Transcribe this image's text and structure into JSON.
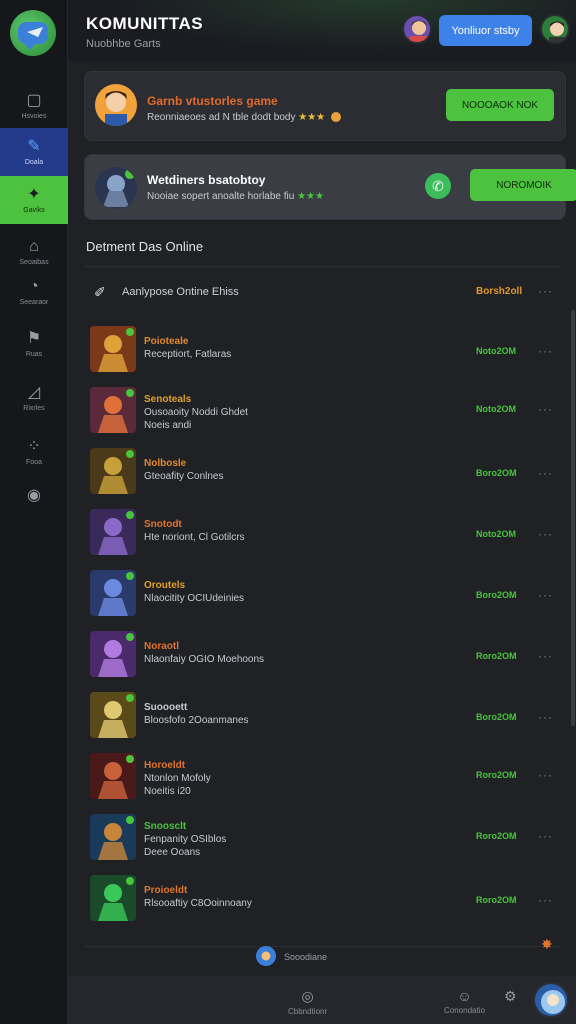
{
  "app": {
    "title": "KOMUNITTAS",
    "subtitle": "Nuobhbe Garts",
    "header_button": "Yonliuor stsby"
  },
  "sidebar": {
    "items": [
      {
        "label": "Hsvoies",
        "icon": "window-icon"
      },
      {
        "label": "Doala",
        "icon": "edit-icon"
      },
      {
        "label": "Gaviks",
        "icon": "gamer-icon"
      },
      {
        "label": "Seoaibas",
        "icon": "home-icon"
      },
      {
        "label": "Seearaor",
        "icon": "compass-icon"
      },
      {
        "label": "Ruas",
        "icon": "flag-icon"
      },
      {
        "label": "Rixrles",
        "icon": "chart-icon"
      },
      {
        "label": "Fooa",
        "icon": "grid-icon"
      },
      {
        "label": "",
        "icon": "gamepad-icon"
      }
    ]
  },
  "cards": [
    {
      "title": "Garnb vtustorles game",
      "subtitle": "Reonniaeoes ad N tble dodt body",
      "button": "NOOOAOK NOK",
      "title_color": "#e06a2c"
    },
    {
      "title": "Wetdiners bsatobtoy",
      "subtitle": "Nooiae sopert anoalte horlabe fiu",
      "button": "NOROMOIK"
    }
  ],
  "section": {
    "title": "Detment Das Online",
    "header": {
      "text": "Aanlypose Ontine Ehiss",
      "date": "Borsh2oll"
    }
  },
  "list": [
    {
      "name": "Poioteale",
      "desc": "Receptiort, Fatlaras",
      "extra": "",
      "date": "Noto2OM",
      "name_color": "#e08a2c"
    },
    {
      "name": "Senoteals",
      "desc": "Ousoaoity Noddi Ghdet",
      "extra": "Noeis andi",
      "date": "Noto2OM",
      "name_color": "#e0a02c"
    },
    {
      "name": "Nolbosle",
      "desc": "Gteoafity Conlnes",
      "extra": "",
      "date": "Boro2OM",
      "name_color": "#e08a2c"
    },
    {
      "name": "Snotodt",
      "desc": "Hte noriont, Cl Gotilcrs",
      "extra": "",
      "date": "Noto2OM",
      "name_color": "#e0742c"
    },
    {
      "name": "Oroutels",
      "desc": "Nlaocitity OCIUdeinies",
      "extra": "",
      "date": "Boro2OM",
      "name_color": "#e0a02c"
    },
    {
      "name": "Noraotl",
      "desc": "Nlaonfaiy OGIO Moehoons",
      "extra": "",
      "date": "Roro2OM",
      "name_color": "#e0742c"
    },
    {
      "name": "Suoooett",
      "desc": "Bloosfofo 2Ooanmanes",
      "extra": "",
      "date": "Boro2OM",
      "name_color": "#c9cbd1"
    },
    {
      "name": "Horoeldt",
      "desc": "Ntonlon Mofoly",
      "extra": "Noeitis i20",
      "date": "Roro2OM",
      "name_color": "#e0742c"
    },
    {
      "name": "Snoosclt",
      "desc": "Fenpanity OSIblos",
      "extra": "Deee Ooans",
      "date": "Roro2OM",
      "name_color": "#49c43d"
    },
    {
      "name": "Proioeldt",
      "desc": "Rlsooaftiy C8Ooinnoany",
      "extra": "",
      "date": "Roro2OM",
      "name_color": "#e0742c"
    }
  ],
  "footer": {
    "user_label": "Sooodiane",
    "nav": [
      {
        "label": "Cbbndtionr",
        "icon": "home-icon"
      },
      {
        "label": "Conondatio",
        "icon": "smile-icon"
      }
    ]
  }
}
